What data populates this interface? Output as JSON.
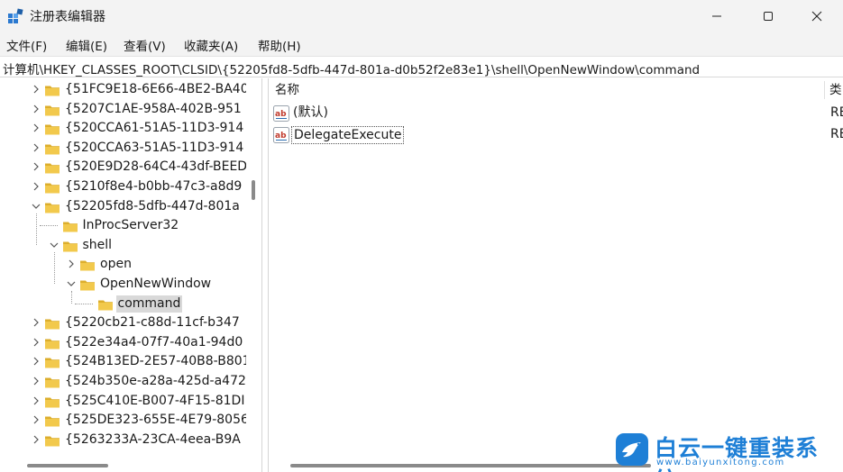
{
  "window": {
    "title": "注册表编辑器",
    "controls": {
      "minimize": "minimize-icon",
      "maximize": "maximize-icon",
      "close": "close-icon"
    }
  },
  "menu": {
    "items": [
      "文件(F)",
      "编辑(E)",
      "查看(V)",
      "收藏夹(A)",
      "帮助(H)"
    ]
  },
  "address": {
    "path": "计算机\\HKEY_CLASSES_ROOT\\CLSID\\{52205fd8-5dfb-447d-801a-d0b52f2e83e1}\\shell\\OpenNewWindow\\command"
  },
  "tree": {
    "nodes": [
      {
        "label": "{51FC9E18-6E66-4BE2-BA40",
        "level": 0,
        "expander": "collapsed"
      },
      {
        "label": "{5207C1AE-958A-402B-951",
        "level": 0,
        "expander": "collapsed"
      },
      {
        "label": "{520CCA61-51A5-11D3-914",
        "level": 0,
        "expander": "collapsed"
      },
      {
        "label": "{520CCA63-51A5-11D3-914",
        "level": 0,
        "expander": "collapsed"
      },
      {
        "label": "{520E9D28-64C4-43df-BEED",
        "level": 0,
        "expander": "collapsed"
      },
      {
        "label": "{5210f8e4-b0bb-47c3-a8d9",
        "level": 0,
        "expander": "collapsed"
      },
      {
        "label": "{52205fd8-5dfb-447d-801a",
        "level": 0,
        "expander": "expanded"
      },
      {
        "label": "InProcServer32",
        "level": 1,
        "expander": "none"
      },
      {
        "label": "shell",
        "level": 1,
        "expander": "expanded"
      },
      {
        "label": "open",
        "level": 2,
        "expander": "collapsed"
      },
      {
        "label": "OpenNewWindow",
        "level": 2,
        "expander": "expanded"
      },
      {
        "label": "command",
        "level": 3,
        "expander": "none",
        "selected": true
      },
      {
        "label": "{5220cb21-c88d-11cf-b347",
        "level": 0,
        "expander": "collapsed"
      },
      {
        "label": "{522e34a4-07f7-40a1-94d0",
        "level": 0,
        "expander": "collapsed"
      },
      {
        "label": "{524B13ED-2E57-40B8-B801",
        "level": 0,
        "expander": "collapsed"
      },
      {
        "label": "{524b350e-a28a-425d-a472",
        "level": 0,
        "expander": "collapsed"
      },
      {
        "label": "{525C410E-B007-4F15-81DI",
        "level": 0,
        "expander": "collapsed"
      },
      {
        "label": "{525DE323-655E-4E79-8056",
        "level": 0,
        "expander": "collapsed"
      },
      {
        "label": "{5263233A-23CA-4eea-B9A",
        "level": 0,
        "expander": "collapsed"
      }
    ]
  },
  "values": {
    "headers": {
      "name": "名称",
      "type": "类"
    },
    "rows": [
      {
        "name": "(默认)",
        "type": "RE",
        "icon": "string-value-icon"
      },
      {
        "name": "DelegateExecute",
        "type": "RE",
        "icon": "string-value-icon",
        "focused": true
      }
    ]
  },
  "watermark": {
    "text": "白云一键重装系统",
    "url": "www.baiyunxitong.com",
    "icon": "bird-logo-icon",
    "color": "#1e7fd6"
  },
  "colors": {
    "folder": "#f2c94c",
    "folder_dark": "#dcae2c",
    "selection": "#d9d9d9",
    "titlebar": "#f3f3f3"
  }
}
